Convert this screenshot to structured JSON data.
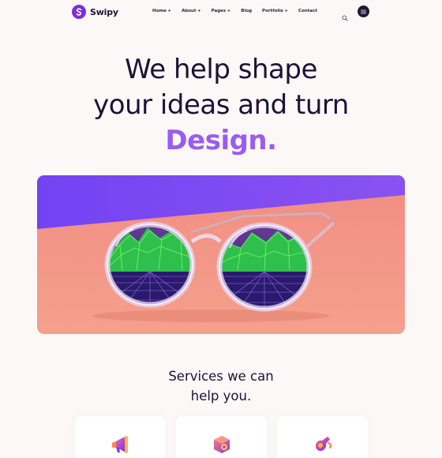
{
  "brand": {
    "name": "Swipy",
    "mark_letter": "S",
    "color": "#7e2fd6"
  },
  "nav": {
    "items": [
      {
        "label": "Home",
        "has_dropdown": true
      },
      {
        "label": "About",
        "has_dropdown": true
      },
      {
        "label": "Pages",
        "has_dropdown": true
      },
      {
        "label": "Blog",
        "has_dropdown": false
      },
      {
        "label": "Portfolio",
        "has_dropdown": true
      },
      {
        "label": "Contact",
        "has_dropdown": false
      }
    ],
    "dropdown_marker": "+",
    "search_icon": "search-icon",
    "menu_icon": "hamburger-icon"
  },
  "hero": {
    "line1": "We help shape",
    "line2": "your ideas and turn",
    "accent": "Design.",
    "accent_color": "#9a5cf0",
    "image": "sunglasses-photo"
  },
  "services": {
    "title_line1": "Services we can",
    "title_line2": "help you.",
    "cards": [
      {
        "icon": "megaphone-icon"
      },
      {
        "icon": "cube-speaker-icon"
      },
      {
        "icon": "rocket-hand-icon"
      }
    ]
  },
  "colors": {
    "text": "#1b1336",
    "background": "#fcf8f8",
    "purple": "#7b4cf1",
    "coral": "#f29383"
  }
}
